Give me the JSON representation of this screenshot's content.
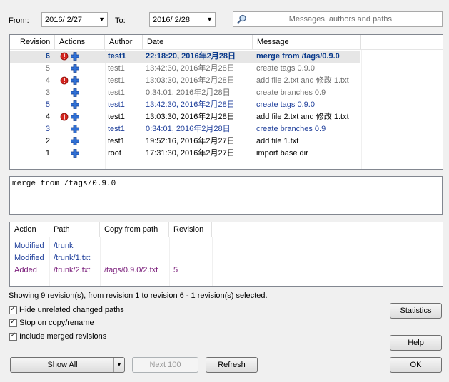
{
  "filter": {
    "from_label": "From:",
    "from_value": "2016/ 2/27",
    "to_label": "To:",
    "to_value": "2016/ 2/28",
    "search_placeholder": "Messages, authors and paths"
  },
  "log": {
    "columns": [
      "Revision",
      "Actions",
      "Author",
      "Date",
      "Message"
    ],
    "rows": [
      {
        "revision": "6",
        "author": "test1",
        "date": "22:18:20, 2016年2月28日",
        "message": "merge from /tags/0.9.0",
        "style": "selected",
        "icons": [
          "conflict-icon",
          "add-icon"
        ]
      },
      {
        "revision": "5",
        "author": "test1",
        "date": "13:42:30, 2016年2月28日",
        "message": "create tags 0.9.0",
        "style": "gray",
        "icons": [
          "add-icon"
        ]
      },
      {
        "revision": "4",
        "author": "test1",
        "date": "13:03:30, 2016年2月28日",
        "message": "add file 2.txt and 修改 1.txt",
        "style": "gray",
        "icons": [
          "conflict-icon",
          "add-icon"
        ]
      },
      {
        "revision": "3",
        "author": "test1",
        "date": "0:34:01, 2016年2月28日",
        "message": "create branches 0.9",
        "style": "gray",
        "icons": [
          "add-icon"
        ]
      },
      {
        "revision": "5",
        "author": "test1",
        "date": "13:42:30, 2016年2月28日",
        "message": "create tags 0.9.0",
        "style": "blue",
        "icons": [
          "add-icon"
        ]
      },
      {
        "revision": "4",
        "author": "test1",
        "date": "13:03:30, 2016年2月28日",
        "message": "add file 2.txt and 修改 1.txt",
        "style": "normal",
        "icons": [
          "conflict-icon",
          "add-icon"
        ]
      },
      {
        "revision": "3",
        "author": "test1",
        "date": "0:34:01, 2016年2月28日",
        "message": "create branches 0.9",
        "style": "blue",
        "icons": [
          "add-icon"
        ]
      },
      {
        "revision": "2",
        "author": "test1",
        "date": "19:52:16, 2016年2月27日",
        "message": "add file 1.txt",
        "style": "normal",
        "icons": [
          "add-icon"
        ]
      },
      {
        "revision": "1",
        "author": "root",
        "date": "17:31:30, 2016年2月27日",
        "message": "import base dir",
        "style": "normal",
        "icons": [
          "add-icon"
        ]
      }
    ]
  },
  "message_text": "merge from /tags/0.9.0",
  "paths": {
    "columns": [
      "Action",
      "Path",
      "Copy from path",
      "Revision"
    ],
    "rows": [
      {
        "action": "Modified",
        "path": "/trunk",
        "copy_from": "",
        "revision": "",
        "style": "blue"
      },
      {
        "action": "Modified",
        "path": "/trunk/1.txt",
        "copy_from": "",
        "revision": "",
        "style": "blue"
      },
      {
        "action": "Added",
        "path": "/trunk/2.txt",
        "copy_from": "/tags/0.9.0/2.txt",
        "revision": "5",
        "style": "purple"
      }
    ]
  },
  "status_text": "Showing 9 revision(s), from revision 1 to revision 6 - 1 revision(s) selected.",
  "options": {
    "hide_unrelated": "Hide unrelated changed paths",
    "stop_on_copy": "Stop on copy/rename",
    "include_merged": "Include merged revisions"
  },
  "buttons": {
    "statistics": "Statistics",
    "help": "Help",
    "show_all": "Show All",
    "next_100": "Next 100",
    "refresh": "Refresh",
    "ok": "OK"
  },
  "colors": {
    "selected_row": "#e6e6e6",
    "blue_text": "#1f3f9b",
    "purple_text": "#7a1d7a",
    "gray_text": "#6d6d6d"
  }
}
